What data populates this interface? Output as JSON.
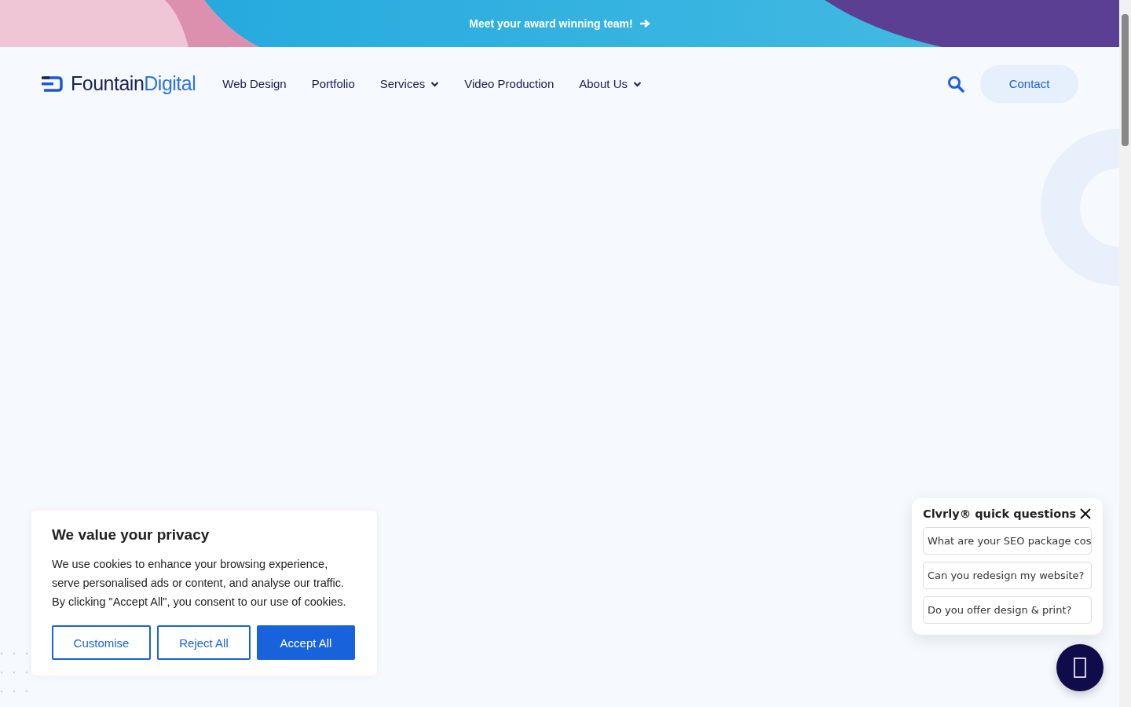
{
  "announcement": {
    "text": "Meet your award winning team!"
  },
  "logo": {
    "first": "Fountain",
    "second": "Digital"
  },
  "nav": [
    {
      "label": "Web Design",
      "has_dropdown": false
    },
    {
      "label": "Portfolio",
      "has_dropdown": false
    },
    {
      "label": "Services",
      "has_dropdown": true
    },
    {
      "label": "Video Production",
      "has_dropdown": false
    },
    {
      "label": "About Us",
      "has_dropdown": true
    }
  ],
  "contact_button": "Contact",
  "cookie_banner": {
    "title": "We value your privacy",
    "body": "We use cookies to enhance your browsing experience, serve personalised ads or content, and analyse our traffic. By clicking \"Accept All\", you consent to our use of cookies.",
    "buttons": [
      {
        "label": "Customise",
        "kind": "outline"
      },
      {
        "label": "Reject All",
        "kind": "outline"
      },
      {
        "label": "Accept All",
        "kind": "primary"
      }
    ]
  },
  "chat": {
    "title": "Clvrly® quick questions",
    "questions": [
      "What are your SEO package cos",
      "Can you redesign my website?",
      "Do you offer design & print?"
    ]
  }
}
